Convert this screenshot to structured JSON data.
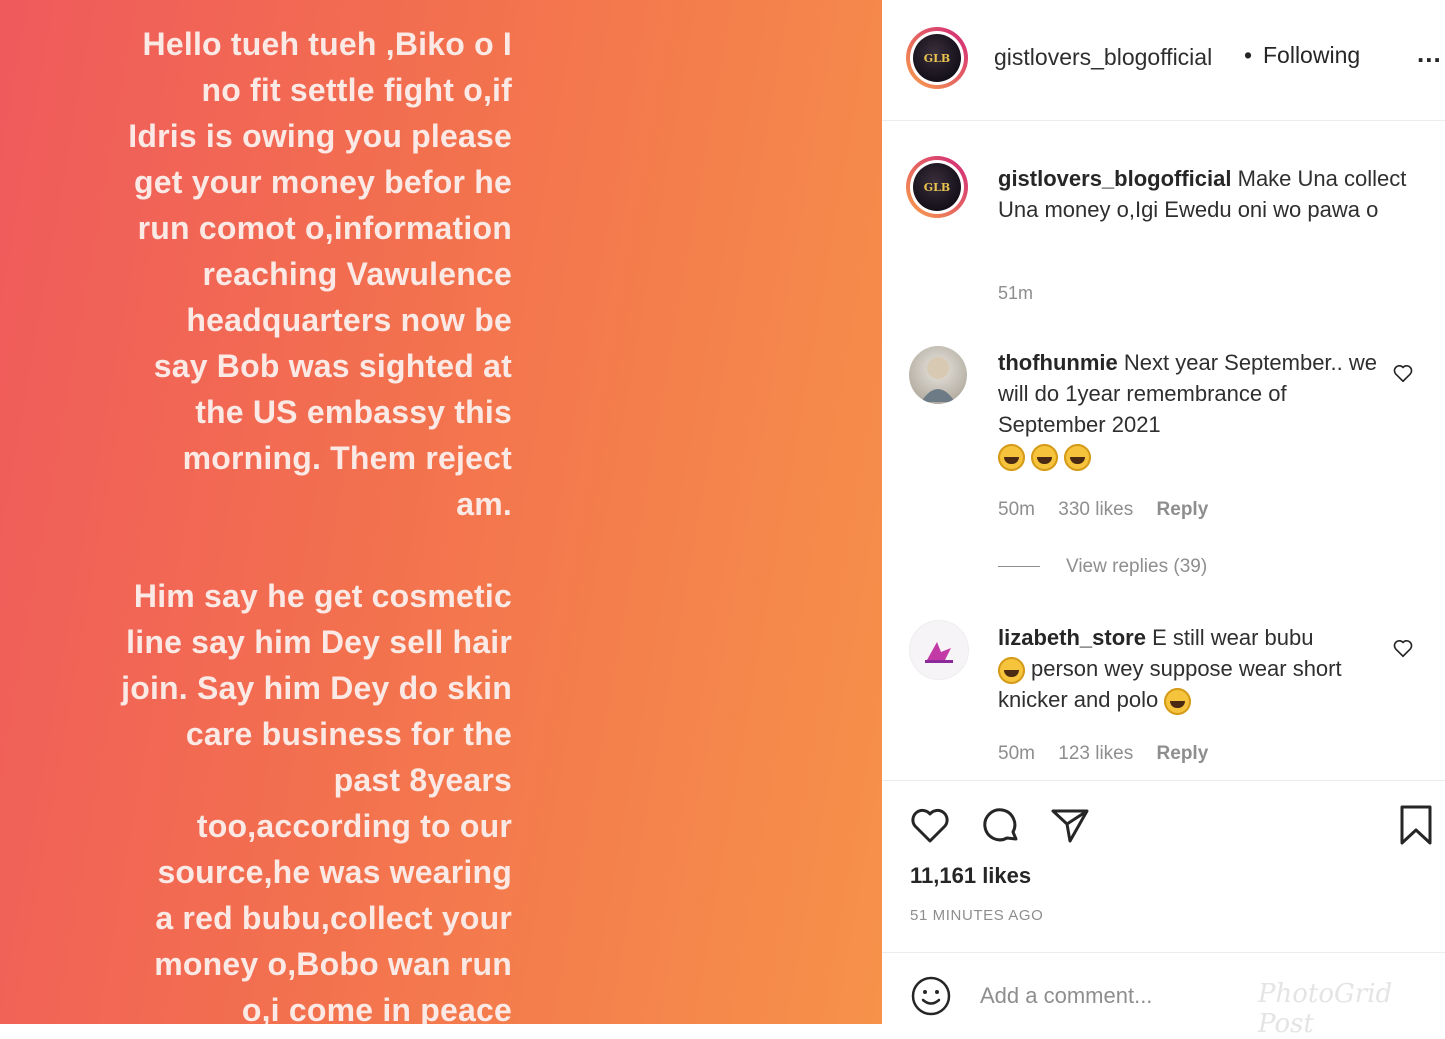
{
  "story": {
    "paragraph1": [
      "Hello tueh tueh ,Biko o I",
      "no fit settle fight o,if",
      "Idris is owing you please",
      "get your money befor he",
      "run comot o,information",
      "reaching Vawulence",
      "headquarters  now  be",
      "say Bob was sighted at",
      "the US embassy this",
      "morning. Them reject",
      "am."
    ],
    "paragraph2": [
      "Him say he get cosmetic",
      "line say him Dey sell hair",
      "join. Say him Dey do skin",
      "care business for the",
      "past 8years",
      "too,according to our",
      "source,he was  wearing",
      "a red bubu,collect your",
      "money o,Bobo wan run",
      "o,i come in peace"
    ]
  },
  "header": {
    "avatar_text": "GLB",
    "username": "gistlovers_blogofficial",
    "separator": "•",
    "follow_status": "Following",
    "more": "..."
  },
  "caption": {
    "username": "gistlovers_blogofficial",
    "text": "Make Una collect Una money o,Igi Ewedu oni wo pawa o",
    "time": "51m"
  },
  "comments": [
    {
      "username": "thofhunmie",
      "text": "Next year September.. we will do 1year remembrance of September 2021",
      "emoji_count": 3,
      "time": "50m",
      "likes": "330 likes",
      "reply": "Reply",
      "view_replies": "View replies (39)"
    },
    {
      "username": "lizabeth_store",
      "text_a": "E still wear bubu",
      "text_b": "person wey suppose wear short knicker and polo",
      "time": "50m",
      "likes": "123 likes",
      "reply": "Reply"
    }
  ],
  "actions": {
    "icons": [
      "heart-icon",
      "comment-icon",
      "share-icon",
      "bookmark-icon"
    ],
    "likes": "11,161 likes",
    "posted": "51 MINUTES AGO"
  },
  "add_comment": {
    "placeholder": "Add a comment...",
    "watermark": "PhotoGrid Post"
  },
  "colors": {
    "story_start": "#ef5a5c",
    "story_end": "#f6924a",
    "ring_start": "#f9a34b",
    "ring_end": "#d0247a",
    "secondary_text": "#8e8e8e"
  }
}
